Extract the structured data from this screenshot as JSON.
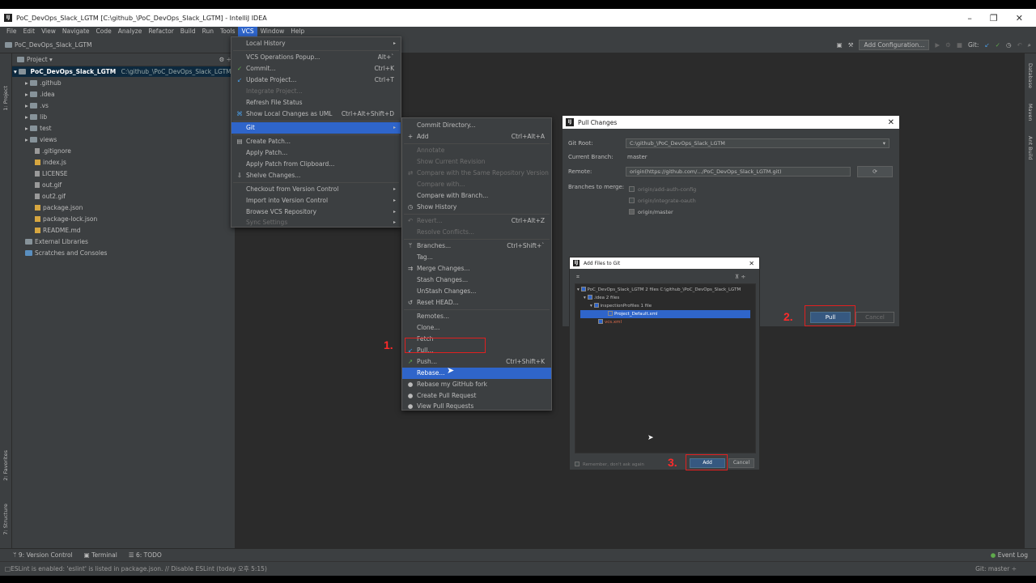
{
  "window": {
    "title": "PoC_DevOps_Slack_LGTM [C:\\github_\\PoC_DevOps_Slack_LGTM] - IntelliJ IDEA",
    "app_icon": "IJ",
    "minimize": "–",
    "maximize": "❐",
    "close": "✕"
  },
  "menu": [
    "File",
    "Edit",
    "View",
    "Navigate",
    "Code",
    "Analyze",
    "Refactor",
    "Build",
    "Run",
    "Tools",
    "VCS",
    "Window",
    "Help"
  ],
  "navbar": {
    "project": "PoC_DevOps_Slack_LGTM",
    "add_configuration": "Add Configuration...",
    "git_label": "Git:"
  },
  "left_strip": [
    "1: Project",
    "2: Favorites",
    "7: Structure"
  ],
  "right_strip": [
    "Database",
    "Maven",
    "Ant Build"
  ],
  "project_panel": {
    "title": "Project ▾",
    "root": "PoC_DevOps_Slack_LGTM",
    "root_path": "C:\\github_\\PoC_DevOps_Slack_LGTM",
    "items": [
      ".github",
      ".idea",
      ".vs",
      "lib",
      "test",
      "views",
      ".gitignore",
      "index.js",
      "LICENSE",
      "out.gif",
      "out2.gif",
      "package.json",
      "package-lock.json",
      "README.md",
      "External Libraries",
      "Scratches and Consoles"
    ]
  },
  "vcs_menu": {
    "items": [
      {
        "label": "Local History",
        "shortcut": "",
        "arrow": "▸"
      },
      {
        "label": "VCS Operations Popup...",
        "shortcut": "Alt+`",
        "arrow": ""
      },
      {
        "label": "Commit...",
        "shortcut": "Ctrl+K",
        "arrow": ""
      },
      {
        "label": "Update Project...",
        "shortcut": "Ctrl+T",
        "arrow": ""
      },
      {
        "label": "Integrate Project...",
        "shortcut": "",
        "arrow": ""
      },
      {
        "label": "Refresh File Status",
        "shortcut": "",
        "arrow": ""
      },
      {
        "label": "Show Local Changes as UML",
        "shortcut": "Ctrl+Alt+Shift+D",
        "arrow": ""
      },
      {
        "label": "Git",
        "shortcut": "",
        "arrow": "▸"
      },
      {
        "label": "Create Patch...",
        "shortcut": "",
        "arrow": ""
      },
      {
        "label": "Apply Patch...",
        "shortcut": "",
        "arrow": ""
      },
      {
        "label": "Apply Patch from Clipboard...",
        "shortcut": "",
        "arrow": ""
      },
      {
        "label": "Shelve Changes...",
        "shortcut": "",
        "arrow": ""
      },
      {
        "label": "Checkout from Version Control",
        "shortcut": "",
        "arrow": "▸"
      },
      {
        "label": "Import into Version Control",
        "shortcut": "",
        "arrow": "▸"
      },
      {
        "label": "Browse VCS Repository",
        "shortcut": "",
        "arrow": "▸"
      },
      {
        "label": "Sync Settings",
        "shortcut": "",
        "arrow": "▸"
      }
    ]
  },
  "git_menu": {
    "items": [
      {
        "label": "Commit Directory...",
        "shortcut": ""
      },
      {
        "label": "Add",
        "shortcut": "Ctrl+Alt+A"
      },
      {
        "label": "Annotate",
        "shortcut": ""
      },
      {
        "label": "Show Current Revision",
        "shortcut": ""
      },
      {
        "label": "Compare with the Same Repository Version",
        "shortcut": ""
      },
      {
        "label": "Compare with...",
        "shortcut": ""
      },
      {
        "label": "Compare with Branch...",
        "shortcut": ""
      },
      {
        "label": "Show History",
        "shortcut": ""
      },
      {
        "label": "Revert...",
        "shortcut": "Ctrl+Alt+Z"
      },
      {
        "label": "Resolve Conflicts...",
        "shortcut": ""
      },
      {
        "label": "Branches...",
        "shortcut": "Ctrl+Shift+`"
      },
      {
        "label": "Tag...",
        "shortcut": ""
      },
      {
        "label": "Merge Changes...",
        "shortcut": ""
      },
      {
        "label": "Stash Changes...",
        "shortcut": ""
      },
      {
        "label": "UnStash Changes...",
        "shortcut": ""
      },
      {
        "label": "Reset HEAD...",
        "shortcut": ""
      },
      {
        "label": "Remotes...",
        "shortcut": ""
      },
      {
        "label": "Clone...",
        "shortcut": ""
      },
      {
        "label": "Fetch",
        "shortcut": ""
      },
      {
        "label": "Pull...",
        "shortcut": ""
      },
      {
        "label": "Push...",
        "shortcut": "Ctrl+Shift+K"
      },
      {
        "label": "Rebase...",
        "shortcut": ""
      },
      {
        "label": "Rebase my GitHub fork",
        "shortcut": ""
      },
      {
        "label": "Create Pull Request",
        "shortcut": ""
      },
      {
        "label": "View Pull Requests",
        "shortcut": ""
      }
    ]
  },
  "pull_dialog": {
    "title": "Pull Changes",
    "git_root_label": "Git Root:",
    "git_root_value": "C:\\github_\\PoC_DevOps_Slack_LGTM",
    "branch_label": "Current Branch:",
    "branch_value": "master",
    "remote_label": "Remote:",
    "remote_value": "origin(https://github.com/.../PoC_DevOps_Slack_LGTM.git)",
    "branches_label": "Branches to merge:",
    "branches": [
      "origin/add-auth-config",
      "origin/integrate-oauth",
      "origin/master"
    ],
    "pull_button": "Pull",
    "cancel_button": "Cancel"
  },
  "add_files_dialog": {
    "title": "Add Files to Git",
    "tree": [
      "PoC_DevOps_Slack_LGTM  2 files  C:\\github_\\PoC_DevOps_Slack_LGTM",
      ".idea  2 files",
      "inspectionProfiles  1 file",
      "Project_Default.xml",
      "vcs.xml"
    ],
    "remember": "Remember, don't ask again",
    "add_button": "Add",
    "cancel_button": "Cancel"
  },
  "annotations": [
    "1.",
    "2.",
    "3."
  ],
  "tool_windows": [
    "9: Version Control",
    "Terminal",
    "6: TODO"
  ],
  "event_log": "Event Log",
  "status_message": "ESLint is enabled: 'eslint' is listed in package.json. // Disable ESLint (today 오후 5:15)",
  "git_status": "Git: master ÷"
}
